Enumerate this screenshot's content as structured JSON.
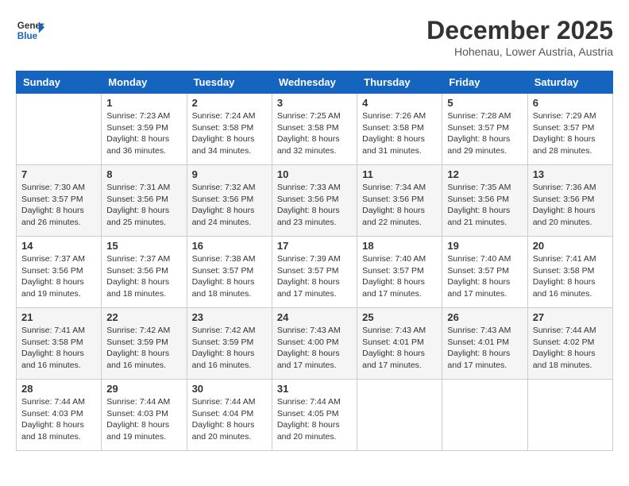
{
  "header": {
    "logo_line1": "General",
    "logo_line2": "Blue",
    "month": "December 2025",
    "location": "Hohenau, Lower Austria, Austria"
  },
  "weekdays": [
    "Sunday",
    "Monday",
    "Tuesday",
    "Wednesday",
    "Thursday",
    "Friday",
    "Saturday"
  ],
  "weeks": [
    [
      {
        "day": "",
        "info": ""
      },
      {
        "day": "1",
        "info": "Sunrise: 7:23 AM\nSunset: 3:59 PM\nDaylight: 8 hours\nand 36 minutes."
      },
      {
        "day": "2",
        "info": "Sunrise: 7:24 AM\nSunset: 3:58 PM\nDaylight: 8 hours\nand 34 minutes."
      },
      {
        "day": "3",
        "info": "Sunrise: 7:25 AM\nSunset: 3:58 PM\nDaylight: 8 hours\nand 32 minutes."
      },
      {
        "day": "4",
        "info": "Sunrise: 7:26 AM\nSunset: 3:58 PM\nDaylight: 8 hours\nand 31 minutes."
      },
      {
        "day": "5",
        "info": "Sunrise: 7:28 AM\nSunset: 3:57 PM\nDaylight: 8 hours\nand 29 minutes."
      },
      {
        "day": "6",
        "info": "Sunrise: 7:29 AM\nSunset: 3:57 PM\nDaylight: 8 hours\nand 28 minutes."
      }
    ],
    [
      {
        "day": "7",
        "info": "Sunrise: 7:30 AM\nSunset: 3:57 PM\nDaylight: 8 hours\nand 26 minutes."
      },
      {
        "day": "8",
        "info": "Sunrise: 7:31 AM\nSunset: 3:56 PM\nDaylight: 8 hours\nand 25 minutes."
      },
      {
        "day": "9",
        "info": "Sunrise: 7:32 AM\nSunset: 3:56 PM\nDaylight: 8 hours\nand 24 minutes."
      },
      {
        "day": "10",
        "info": "Sunrise: 7:33 AM\nSunset: 3:56 PM\nDaylight: 8 hours\nand 23 minutes."
      },
      {
        "day": "11",
        "info": "Sunrise: 7:34 AM\nSunset: 3:56 PM\nDaylight: 8 hours\nand 22 minutes."
      },
      {
        "day": "12",
        "info": "Sunrise: 7:35 AM\nSunset: 3:56 PM\nDaylight: 8 hours\nand 21 minutes."
      },
      {
        "day": "13",
        "info": "Sunrise: 7:36 AM\nSunset: 3:56 PM\nDaylight: 8 hours\nand 20 minutes."
      }
    ],
    [
      {
        "day": "14",
        "info": "Sunrise: 7:37 AM\nSunset: 3:56 PM\nDaylight: 8 hours\nand 19 minutes."
      },
      {
        "day": "15",
        "info": "Sunrise: 7:37 AM\nSunset: 3:56 PM\nDaylight: 8 hours\nand 18 minutes."
      },
      {
        "day": "16",
        "info": "Sunrise: 7:38 AM\nSunset: 3:57 PM\nDaylight: 8 hours\nand 18 minutes."
      },
      {
        "day": "17",
        "info": "Sunrise: 7:39 AM\nSunset: 3:57 PM\nDaylight: 8 hours\nand 17 minutes."
      },
      {
        "day": "18",
        "info": "Sunrise: 7:40 AM\nSunset: 3:57 PM\nDaylight: 8 hours\nand 17 minutes."
      },
      {
        "day": "19",
        "info": "Sunrise: 7:40 AM\nSunset: 3:57 PM\nDaylight: 8 hours\nand 17 minutes."
      },
      {
        "day": "20",
        "info": "Sunrise: 7:41 AM\nSunset: 3:58 PM\nDaylight: 8 hours\nand 16 minutes."
      }
    ],
    [
      {
        "day": "21",
        "info": "Sunrise: 7:41 AM\nSunset: 3:58 PM\nDaylight: 8 hours\nand 16 minutes."
      },
      {
        "day": "22",
        "info": "Sunrise: 7:42 AM\nSunset: 3:59 PM\nDaylight: 8 hours\nand 16 minutes."
      },
      {
        "day": "23",
        "info": "Sunrise: 7:42 AM\nSunset: 3:59 PM\nDaylight: 8 hours\nand 16 minutes."
      },
      {
        "day": "24",
        "info": "Sunrise: 7:43 AM\nSunset: 4:00 PM\nDaylight: 8 hours\nand 17 minutes."
      },
      {
        "day": "25",
        "info": "Sunrise: 7:43 AM\nSunset: 4:01 PM\nDaylight: 8 hours\nand 17 minutes."
      },
      {
        "day": "26",
        "info": "Sunrise: 7:43 AM\nSunset: 4:01 PM\nDaylight: 8 hours\nand 17 minutes."
      },
      {
        "day": "27",
        "info": "Sunrise: 7:44 AM\nSunset: 4:02 PM\nDaylight: 8 hours\nand 18 minutes."
      }
    ],
    [
      {
        "day": "28",
        "info": "Sunrise: 7:44 AM\nSunset: 4:03 PM\nDaylight: 8 hours\nand 18 minutes."
      },
      {
        "day": "29",
        "info": "Sunrise: 7:44 AM\nSunset: 4:03 PM\nDaylight: 8 hours\nand 19 minutes."
      },
      {
        "day": "30",
        "info": "Sunrise: 7:44 AM\nSunset: 4:04 PM\nDaylight: 8 hours\nand 20 minutes."
      },
      {
        "day": "31",
        "info": "Sunrise: 7:44 AM\nSunset: 4:05 PM\nDaylight: 8 hours\nand 20 minutes."
      },
      {
        "day": "",
        "info": ""
      },
      {
        "day": "",
        "info": ""
      },
      {
        "day": "",
        "info": ""
      }
    ]
  ]
}
